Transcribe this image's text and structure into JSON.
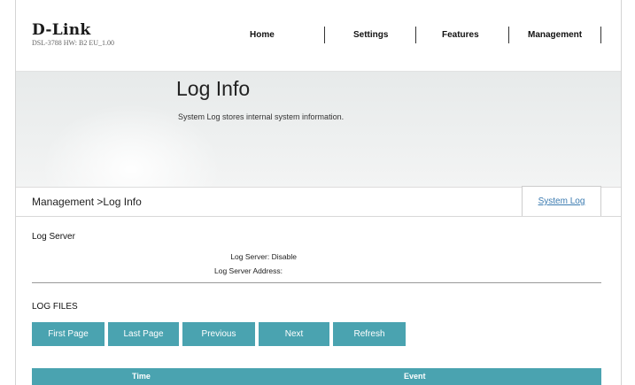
{
  "header": {
    "brand": "D-Link",
    "model_info": "DSL-3788  HW: B2  EU_1.00",
    "nav": [
      "Home",
      "Settings",
      "Features",
      "Management"
    ]
  },
  "banner": {
    "title": "Log Info",
    "description": "System Log stores internal system information."
  },
  "breadcrumb": {
    "path": "Management >Log Info",
    "tab_system_log": "System Log"
  },
  "log_server": {
    "section_title": "Log Server",
    "status_label": "Log Server:",
    "status_value": "Disable",
    "address_label": "Log Server Address:",
    "address_value": ""
  },
  "log_files": {
    "section_title": "LOG FILES",
    "buttons": [
      "First Page",
      "Last Page",
      "Previous",
      "Next",
      "Refresh"
    ],
    "table_headers": [
      "Time",
      "Event"
    ]
  },
  "colors": {
    "accent": "#4aa3b0",
    "link": "#3a7ab0"
  }
}
